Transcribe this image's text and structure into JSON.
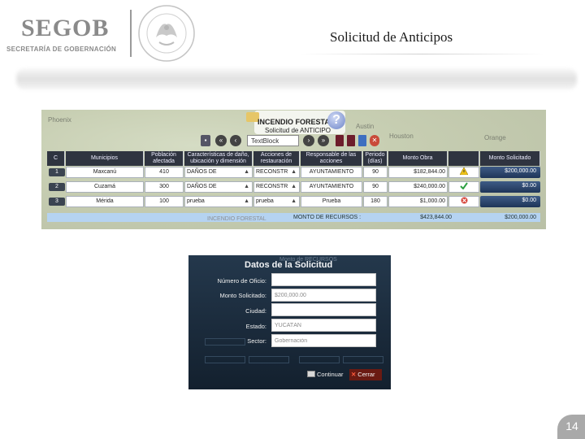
{
  "header": {
    "logo_main": "SEGOB",
    "logo_sub": "SECRETARÍA DE GOBERNACIÓN",
    "slide_title": "Solicitud de Anticipos",
    "seal_icon": "mexico-coat-of-arms-seal-icon"
  },
  "screenshot1": {
    "map_labels": [
      "Austin",
      "Houston",
      "Orange",
      "Phoenix"
    ],
    "banner_title": "INCENDIO FORESTAL",
    "banner_subtitle": "Solicitud de ANTICIPO",
    "help_icon": "help-question-icon",
    "toolbar": {
      "page_input_value": "TextBlock",
      "first_label": "«",
      "prev_label": "‹",
      "next_label": "›",
      "last_label": "»"
    },
    "columns": [
      "C",
      "Municipios",
      "Población afectada",
      "Características de daño, ubicación y dimensión",
      "Acciones de restauración",
      "Responsable de las acciones",
      "Periodo (días)",
      "Monto Obra",
      "",
      "Monto Solicitado"
    ],
    "rows": [
      {
        "num": "1",
        "municipio": "Maxcanú",
        "poblacion": "410",
        "danos": "DAÑOS DE",
        "acciones": "RECONSTR",
        "responsable": "AYUNTAMIENTO",
        "periodo": "90",
        "monto_obra": "$182,844.00",
        "status_icon": "warning-icon",
        "monto_solicitado": "$200,000.00"
      },
      {
        "num": "2",
        "municipio": "Cuzamá",
        "poblacion": "300",
        "danos": "DAÑOS DE",
        "acciones": "RECONSTR",
        "responsable": "AYUNTAMIENTO",
        "periodo": "90",
        "monto_obra": "$240,000.00",
        "status_icon": "check-icon",
        "monto_solicitado": "$0.00"
      },
      {
        "num": "3",
        "municipio": "Mérida",
        "poblacion": "100",
        "danos": "prueba",
        "acciones": "prueba",
        "responsable": "Prueba",
        "periodo": "180",
        "monto_obra": "$1,000.00",
        "status_icon": "error-icon",
        "monto_solicitado": "$0.00"
      }
    ],
    "total_label": "MONTO DE RECURSOS :",
    "total_monto": "$423,844.00",
    "total_solicitado": "$200,000.00",
    "ghost_text": "INCENDIO FORESTAL"
  },
  "dialog": {
    "ghost_title": "Monto de RECURSOS",
    "title": "Datos de la Solicitud",
    "fields": [
      {
        "label": "Número de Oficio:",
        "value": ""
      },
      {
        "label": "Monto Solicitado:",
        "value": "$200,000.00"
      },
      {
        "label": "Ciudad:",
        "value": ""
      },
      {
        "label": "Estado:",
        "value": "YUCATÁN"
      },
      {
        "label": "Sector:",
        "value": "Gobernación"
      }
    ],
    "continue_label": "Continuar",
    "close_label": "Cerrar"
  },
  "page_number": "14",
  "colors": {
    "header_dark": "#2f3440",
    "solicitado_blue": "#2a4470",
    "total_bar": "#b5d3f1",
    "dialog_bg": "#1c2d3d",
    "close_button": "#6a1a12",
    "page_badge": "#a9a9a9"
  }
}
